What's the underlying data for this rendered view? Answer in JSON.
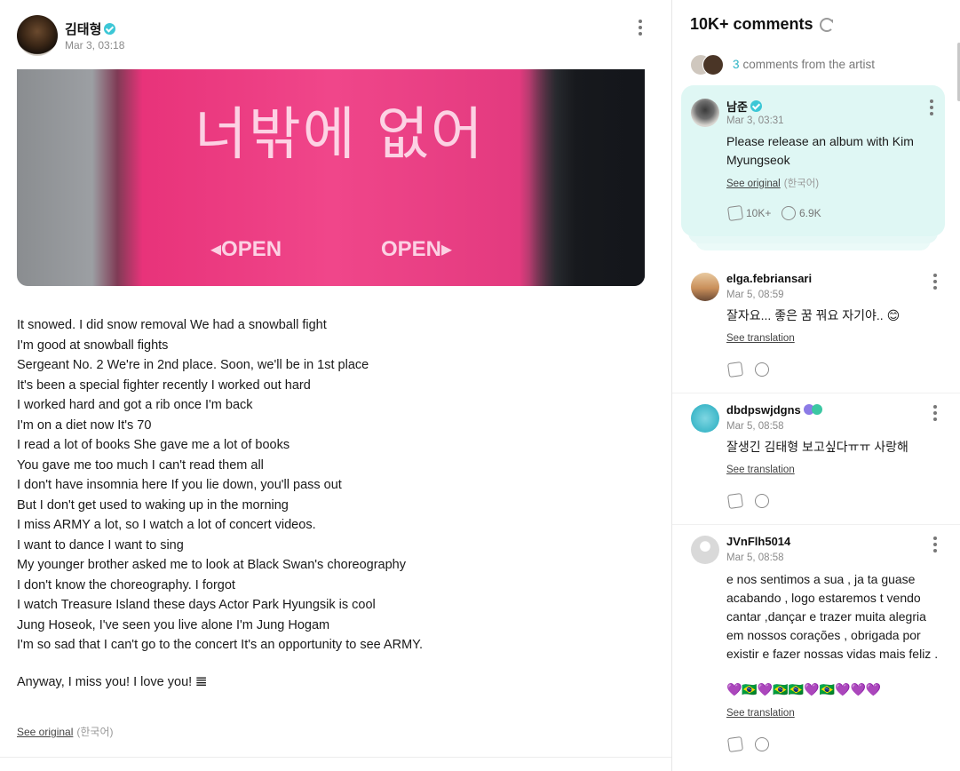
{
  "post": {
    "author": "김태형",
    "date": "Mar 3, 03:18",
    "image_text": {
      "korean": "너밖에 없어",
      "open_left": "◂OPEN",
      "open_right": "OPEN▸"
    },
    "body_lines": [
      "It snowed. I did snow removal We had a snowball fight",
      "I'm good at snowball fights",
      "Sergeant No. 2 We're in 2nd place. Soon, we'll be in 1st place",
      "It's been a special fighter recently I worked out hard",
      "I worked hard and got a rib once I'm back",
      "I'm on a diet now It's 70",
      "I read a lot of books She gave me a lot of books",
      "You gave me too much I can't read them all",
      "I don't have insomnia here If you lie down, you'll pass out",
      "But I don't get used to waking up in the morning",
      "I miss ARMY a lot, so I watch a lot of concert videos.",
      "I want to dance I want to sing",
      "My younger brother asked me to look at Black Swan's choreography",
      "I don't know the choreography. I forgot",
      "I watch Treasure Island these days Actor Park Hyungsik is cool",
      "Jung Hoseok, I've seen you live alone I'm Jung Hogam",
      "I'm so sad that I can't go to the concert It's an opportunity to see ARMY."
    ],
    "sign_off": "Anyway, I miss you! I love you! 𝌆",
    "see_original": "See original",
    "language": "(한국어)"
  },
  "comments": {
    "title": "10K+ comments",
    "artist_count": "3",
    "artist_label": "comments from the artist",
    "highlight": {
      "name": "남준",
      "date": "Mar 3, 03:31",
      "text": "Please release an album with Kim Myungseok",
      "see_original": "See original",
      "language": "(한국어)",
      "repost_count": "10K+",
      "reply_count": "6.9K"
    },
    "items": [
      {
        "name": "elga.febriansari",
        "date": "Mar 5, 08:59",
        "text": "잘자요... 좋은 꿈 꿔요 자기야.. 😊",
        "see_translation": "See translation"
      },
      {
        "name": "dbdpswjdgns",
        "date": "Mar 5, 08:58",
        "text": "잘생긴 김태형 보고싶다ㅠㅠ 사랑해",
        "see_translation": "See translation"
      },
      {
        "name": "JVnFlh5014",
        "date": "Mar 5, 08:58",
        "text": "e nos sentimos a sua , ja ta guase acabando , logo estaremos t vendo cantar ,dançar e trazer muita alegria em nossos corações , obrigada por existir e fazer nossas vidas mais feliz .",
        "emojis": "💜🇧🇷💜🇧🇷🇧🇷💜🇧🇷💜💜💜",
        "see_translation": "See translation"
      }
    ]
  },
  "colors": {
    "accent": "#2bb3c4",
    "highlight_bg": "#dff7f4",
    "brand_pink": "#f0468a"
  },
  "icons": {
    "verified": "verified-badge-icon",
    "more": "kebab-menu-icon",
    "refresh": "refresh-icon",
    "repost": "repost-icon",
    "reply": "reply-icon"
  }
}
